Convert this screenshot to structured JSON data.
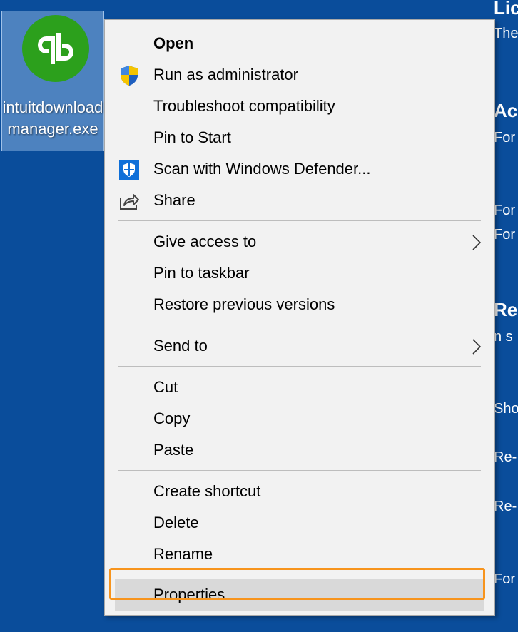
{
  "desktop": {
    "file_icon": {
      "icon": "quickbooks-logo-icon",
      "brand_color": "#2ca01c",
      "label": "intuitdownloadmanager.exe"
    },
    "background_window": {
      "fragments": [
        "Lic",
        "The",
        "Ac",
        "For",
        "For",
        "For",
        "Re",
        "n s",
        "Sho",
        "Re-",
        "Re-",
        "For"
      ]
    }
  },
  "context_menu": {
    "sections": [
      {
        "items": [
          {
            "label": "Open",
            "bold": true,
            "icon": null
          },
          {
            "label": "Run as administrator",
            "icon": "uac-shield-icon"
          },
          {
            "label": "Troubleshoot compatibility",
            "icon": null
          },
          {
            "label": "Pin to Start",
            "icon": null
          },
          {
            "label": "Scan with Windows Defender...",
            "icon": "windows-defender-icon"
          },
          {
            "label": "Share",
            "icon": "share-icon"
          }
        ]
      },
      {
        "items": [
          {
            "label": "Give access to",
            "submenu": true
          },
          {
            "label": "Pin to taskbar"
          },
          {
            "label": "Restore previous versions"
          }
        ]
      },
      {
        "items": [
          {
            "label": "Send to",
            "submenu": true
          }
        ]
      },
      {
        "items": [
          {
            "label": "Cut"
          },
          {
            "label": "Copy"
          },
          {
            "label": "Paste"
          }
        ]
      },
      {
        "items": [
          {
            "label": "Create shortcut"
          },
          {
            "label": "Delete"
          },
          {
            "label": "Rename"
          }
        ]
      },
      {
        "items": [
          {
            "label": "Properties",
            "highlighted": true
          }
        ]
      }
    ]
  },
  "annotation": {
    "target": "Properties",
    "color": "#f7941d"
  }
}
